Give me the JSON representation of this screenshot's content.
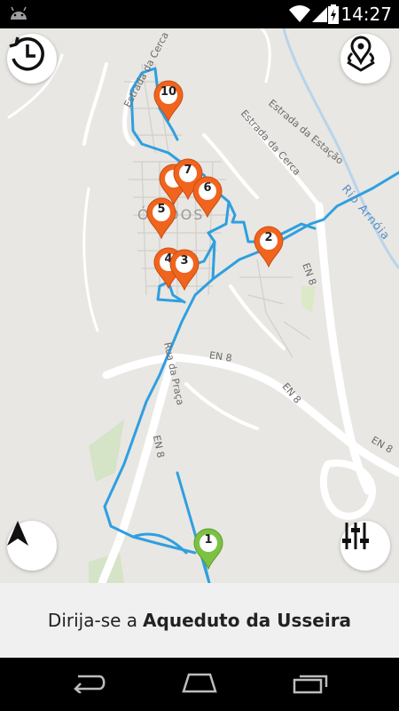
{
  "status_bar": {
    "time": "14:27"
  },
  "map": {
    "road_labels": [
      "Estrada da Cerca",
      "Estrada da Cerca",
      "Estrada da Estação",
      "Rio Arnóia",
      "EN 8",
      "EN 8",
      "EN 8",
      "EN 8",
      "EN 8",
      "Rua da Praça",
      "ÓBIDOS"
    ],
    "pins": [
      {
        "label": "10",
        "color": "#f0641e"
      },
      {
        "label": "7",
        "color": "#f0641e"
      },
      {
        "label": "6",
        "color": "#f0641e"
      },
      {
        "label": "5",
        "color": "#f0641e"
      },
      {
        "label": "4",
        "color": "#f0641e"
      },
      {
        "label": "3",
        "color": "#f0641e"
      },
      {
        "label": "2",
        "color": "#f0641e"
      },
      {
        "label": "1",
        "color": "#7cc242"
      }
    ],
    "route_color": "#2f9fe0"
  },
  "buttons": {
    "history": "history-icon",
    "map_pins": "map-pins-icon",
    "navigate": "navigation-arrow-icon",
    "filters": "sliders-icon"
  },
  "banner": {
    "prefix": "Dirija-se a",
    "destination": "Aqueduto da Usseira"
  },
  "navbar": {
    "back": "back-icon",
    "home": "home-icon",
    "recents": "recents-icon"
  }
}
